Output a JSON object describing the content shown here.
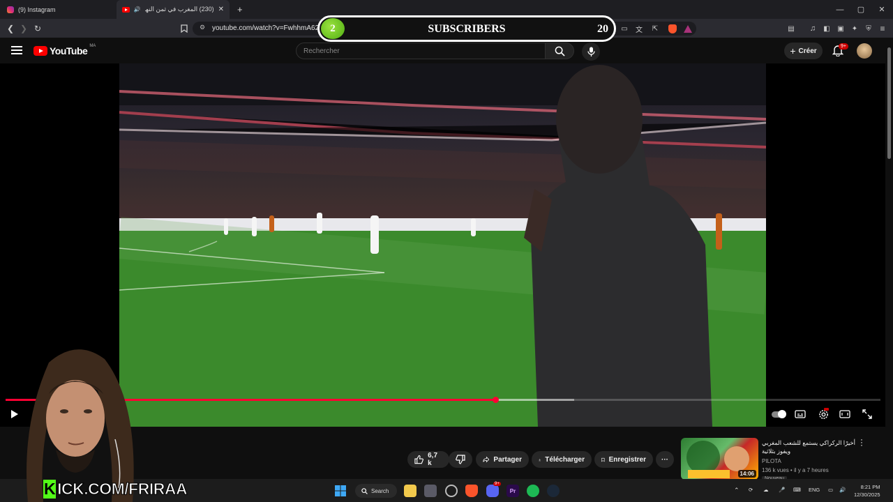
{
  "browser": {
    "tabs": [
      {
        "label": "(9) Instagram",
        "icon": "instagram-icon"
      },
      {
        "label": "(230) المغرب في ثمن النهائي !",
        "icon": "youtube-icon"
      }
    ],
    "new_tab": "+",
    "url": "youtube.com/watch?v=FwhhmA62V",
    "window_controls": [
      "—",
      "▢",
      "✕"
    ]
  },
  "overlay": {
    "subscriber_goal_current": "2",
    "subscriber_label": "SUBSCRIBERS",
    "subscriber_goal_target": "20",
    "kick_text": "KICK.COM/FRIRAA",
    "kick_prefix": "K"
  },
  "youtube": {
    "logo_text": "YouTube",
    "country_code": "MA",
    "search_placeholder": "Rechercher",
    "create_label": "Créer",
    "notification_badge": "9+",
    "accent": "#ff0033"
  },
  "player": {
    "progress": 0.56,
    "buffered": 0.65
  },
  "actions": {
    "likes": "6,7 k",
    "share": "Partager",
    "download": "Télécharger",
    "save": "Enregistrer",
    "more": "···"
  },
  "related": {
    "title": "أخيرًا الركراكي يستمع للشعب المغربي ويفوز بثلاثية",
    "channel": "PILOTA",
    "meta": "136 k vues • il y a 7 heures",
    "duration": "14:06",
    "badge": "Nouveau"
  },
  "taskbar": {
    "search_label": "Search",
    "language": "ENG",
    "time": "8:21 PM",
    "date": "12/30/2025",
    "discord_badge": "9+"
  }
}
